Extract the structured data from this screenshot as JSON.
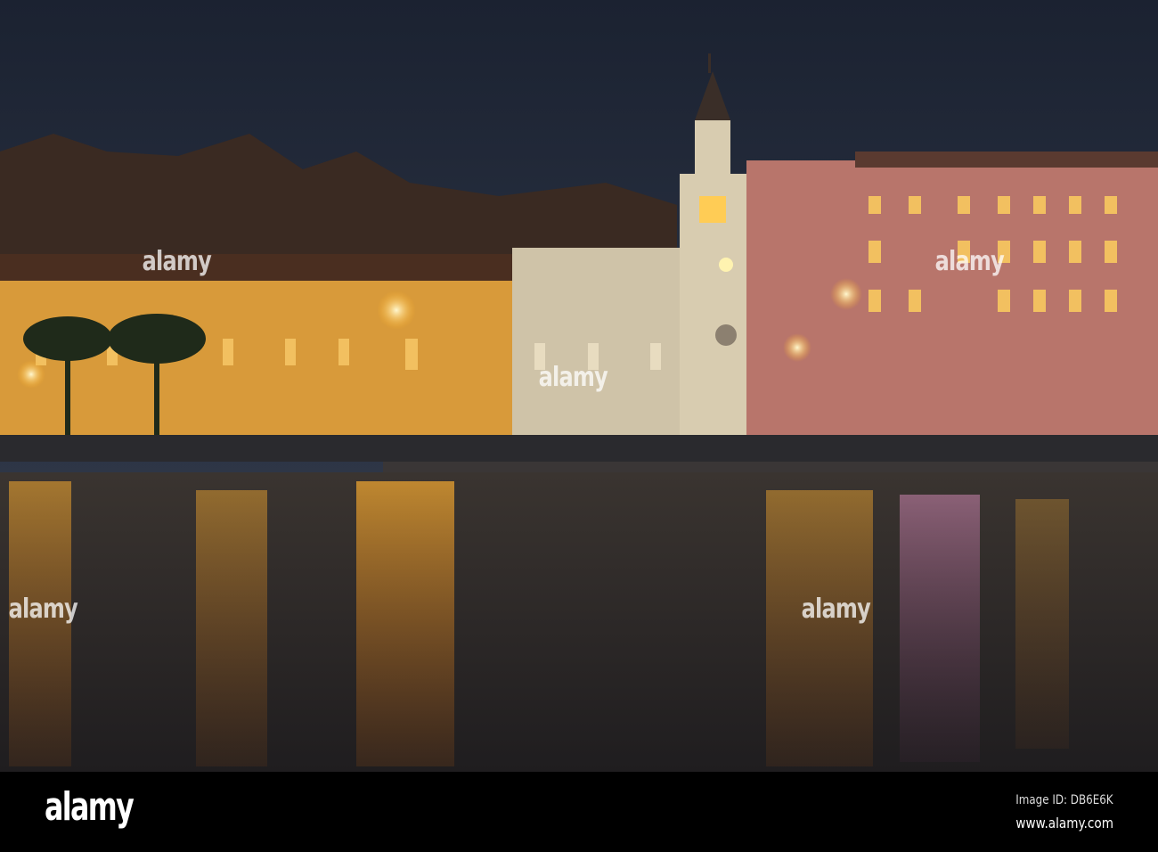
{
  "photo": {
    "subject": "waterfront-night-scene"
  },
  "watermark": {
    "text": "alamy"
  },
  "footer": {
    "logo": "alamy",
    "image_id": "Image ID: DB6E6K",
    "url": "www.alamy.com"
  }
}
